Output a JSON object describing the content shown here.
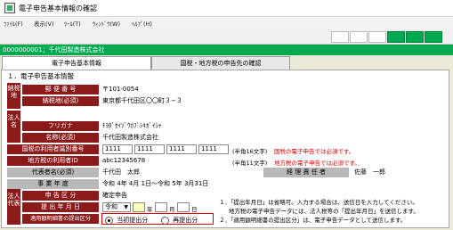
{
  "window": {
    "title": "電子申告基本情報の確認"
  },
  "menu": [
    "ﾌｧｲﾙ(F)",
    "表示(V)",
    "ﾂｰﾙ(T)",
    "ｳｨﾝﾄﾞｳ(W)",
    "ﾍﾙﾌﾟ(H)"
  ],
  "company_bar": "0000000001；千代田製造株式会社",
  "tabs": [
    "電子申告基本情報",
    "国税・地方税の申告先の確認"
  ],
  "section_title": "１．電子申告基本情報",
  "groups": {
    "nouzeichi": "納税地",
    "houjin": "法人名",
    "houjin_daihyo": "法人代表"
  },
  "labels": {
    "postal": "郵 便 番 号",
    "address": "納税地(必須)",
    "furigana": "フリガナ",
    "name": "名称(必須)",
    "kokuzei_id": "国税の利用者識別番号",
    "chihouzei_id": "地方税の利用者ID",
    "representative": "代表者名(必須)",
    "accountant": "経 理 責 任 者",
    "fiscal_year": "事 業 年 度",
    "filing_type": "申 告 区 分",
    "filing_date": "提 出 年 月 日",
    "disclosure": "適用額明細書の提出区分"
  },
  "values": {
    "postal": "〒101-0054",
    "address": "東京都千代田区〇〇町３−３",
    "furigana": "ﾁﾖﾀﾞｾｲｿﾞｳｶﾌﾞｼｷｶﾞｲｼｬ",
    "name": "千代田製造株式会社",
    "kokuzei_id": [
      "1111",
      "1111",
      "1111",
      "1111"
    ],
    "kokuzei_note": "(半角16文字)",
    "kokuzei_warn": "国税の電子申告では必須です。",
    "chihouzei_id": "abc12345678",
    "chihouzei_note": "(半角11文字)",
    "chihouzei_warn": "地方税の電子申告では必須です。",
    "representative": "千代田　太郎",
    "accountant": "佐藤　一郎",
    "fiscal_year": "令和 4年 4月 1日～令和 5年 3月31日",
    "filing_type": "確定申告",
    "era": "令和",
    "year_unit": "年",
    "month_unit": "月",
    "day_unit": "日"
  },
  "notes": [
    "１．「提出年月日」は省略可。入力する場合は、送信日を入力してください。",
    "地方税の電子申告データには、法人税等の「提出年月日」を送信します。",
    "２．「適用額明細書の提出区分」は、電子申告データとして送信します。"
  ],
  "radio": {
    "option1": "当初提出分",
    "option2": "再提出分",
    "selected": "option1"
  },
  "colors": {
    "green": "#00a84f",
    "label_red": "#8b1a1a",
    "warn": "#e00000"
  }
}
